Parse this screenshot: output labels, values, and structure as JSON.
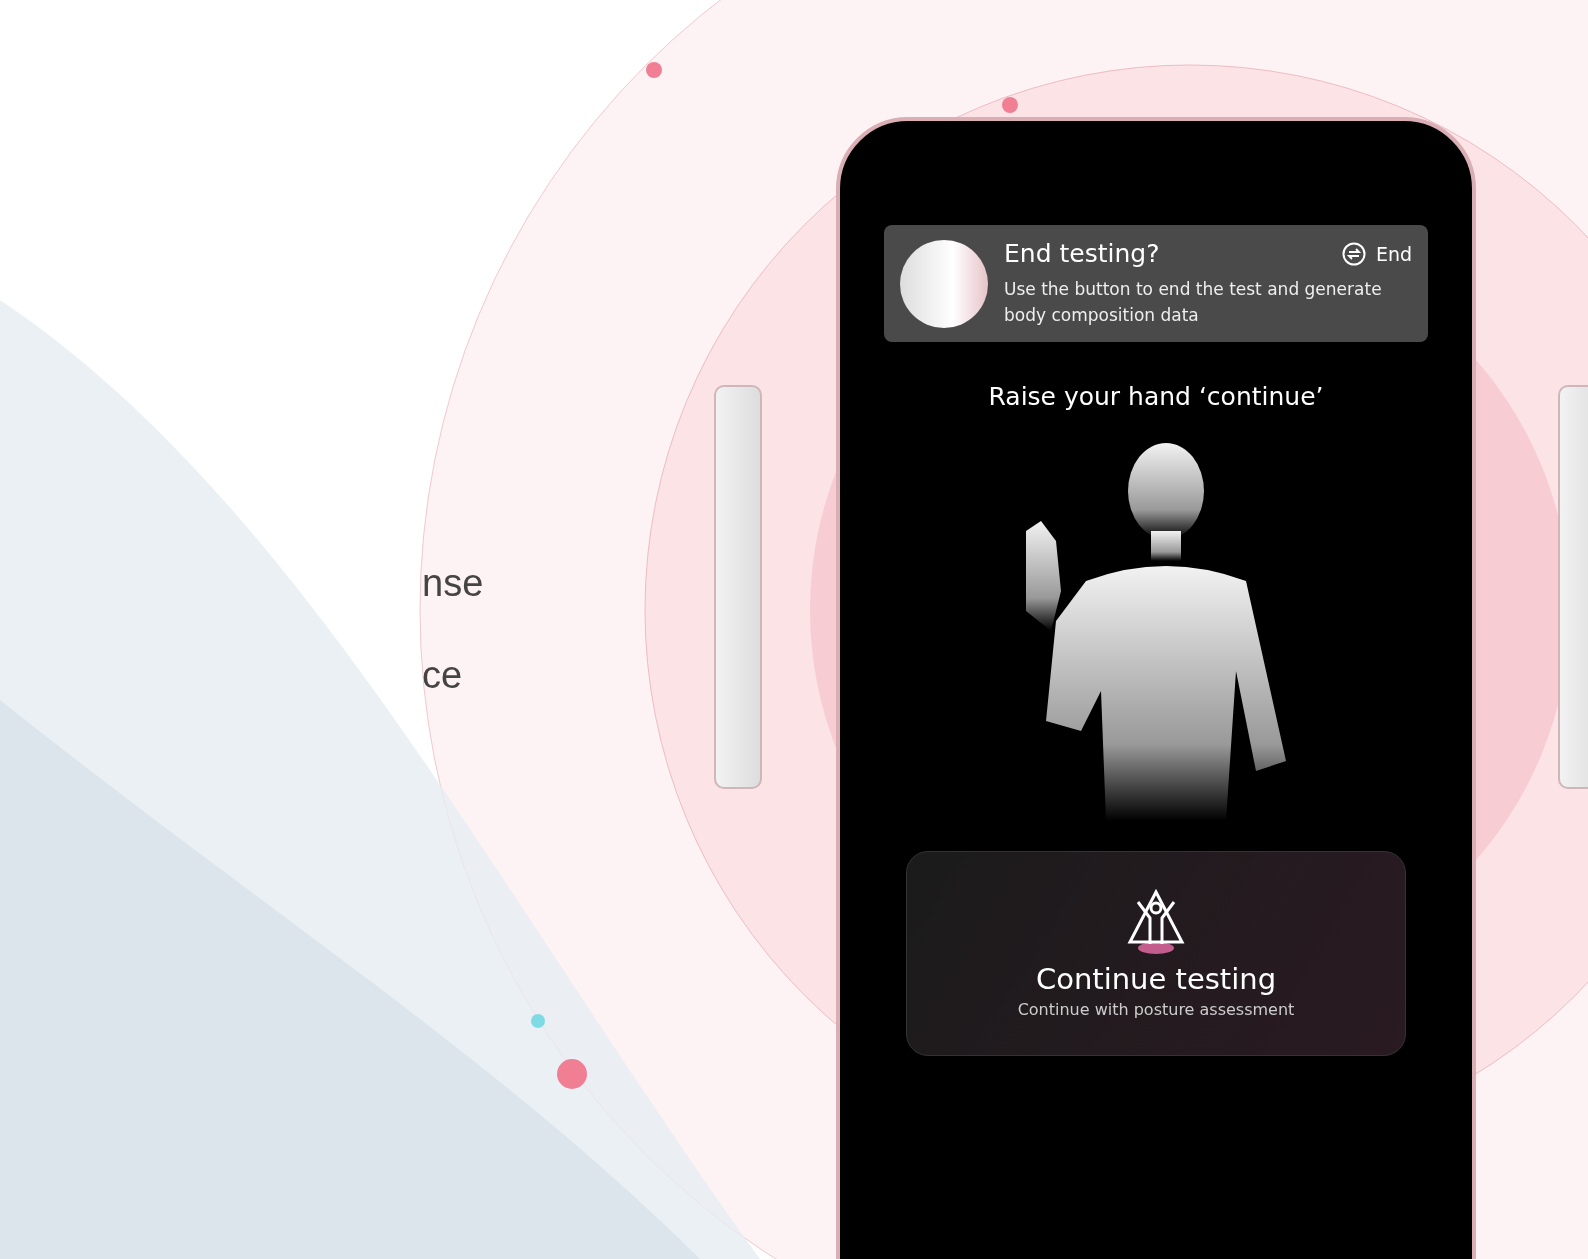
{
  "side_text": [
    "nse",
    "ce"
  ],
  "notification": {
    "title": "End testing?",
    "action": "End",
    "message": "Use the button to end the test and generate body composition data"
  },
  "prompt": "Raise your hand ‘continue’",
  "continue_card": {
    "title": "Continue testing",
    "subtitle": "Continue with posture assessment"
  }
}
